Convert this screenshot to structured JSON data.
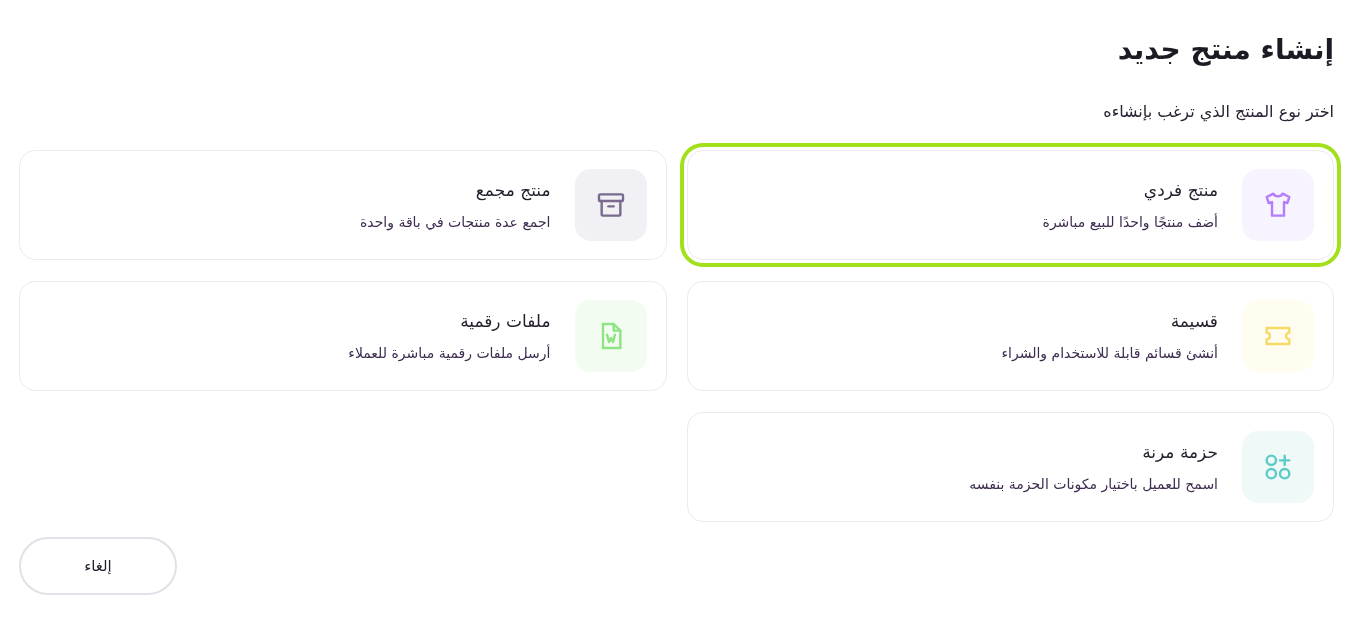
{
  "dialog": {
    "title": "إنشاء منتج جديد",
    "subtitle": "اختر نوع المنتج الذي ترغب بإنشاءه"
  },
  "product_types": [
    {
      "kind": "single",
      "title": "منتج فردي",
      "description": "أضف منتجًا واحدًا للبيع مباشرة",
      "selected": true
    },
    {
      "kind": "bundle",
      "title": "منتج مجمع",
      "description": "اجمع عدة منتجات في باقة واحدة",
      "selected": false
    },
    {
      "kind": "coupon",
      "title": "قسيمة",
      "description": "أنشئ قسائم قابلة للاستخدام والشراء",
      "selected": false
    },
    {
      "kind": "digital",
      "title": "ملفات رقمية",
      "description": "أرسل ملفات رقمية مباشرة للعملاء",
      "selected": false
    },
    {
      "kind": "flexible",
      "title": "حزمة مرنة",
      "description": "اسمح للعميل باختيار مكونات الحزمة بنفسه",
      "selected": false
    }
  ],
  "buttons": [
    {
      "label": "إلغاء"
    }
  ]
}
